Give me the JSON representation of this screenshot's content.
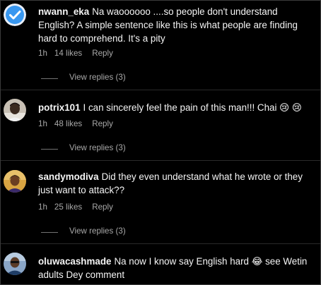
{
  "comments": [
    {
      "username": "nwann_eka",
      "text": "Na waoooooo ....so people don't understand English? A simple sentence like this is what people are finding hard to comprehend. It's a pity",
      "time": "1h",
      "likes": "14 likes",
      "reply": "Reply",
      "view_replies": "View replies (3)",
      "avatar_icon": "verified-badge-icon"
    },
    {
      "username": "potrix101",
      "text": "I can sincerely feel the pain of this man!!! Chai 😢 😢",
      "time": "1h",
      "likes": "48 likes",
      "reply": "Reply",
      "view_replies": "View replies (3)",
      "avatar_icon": "profile-photo"
    },
    {
      "username": "sandymodiva",
      "text": "Did they even understand what he wrote or they just want to attack??",
      "time": "1h",
      "likes": "25 likes",
      "reply": "Reply",
      "view_replies": "View replies (3)",
      "avatar_icon": "profile-photo"
    },
    {
      "username": "oluwacashmade",
      "text": "Na now I know say English hard 😂 see Wetin adults Dey comment",
      "avatar_icon": "profile-photo"
    }
  ],
  "colors": {
    "background": "#000000",
    "text": "#f5f5f5",
    "secondary_text": "#a8a8a8",
    "verified_blue": "#3897f0"
  }
}
